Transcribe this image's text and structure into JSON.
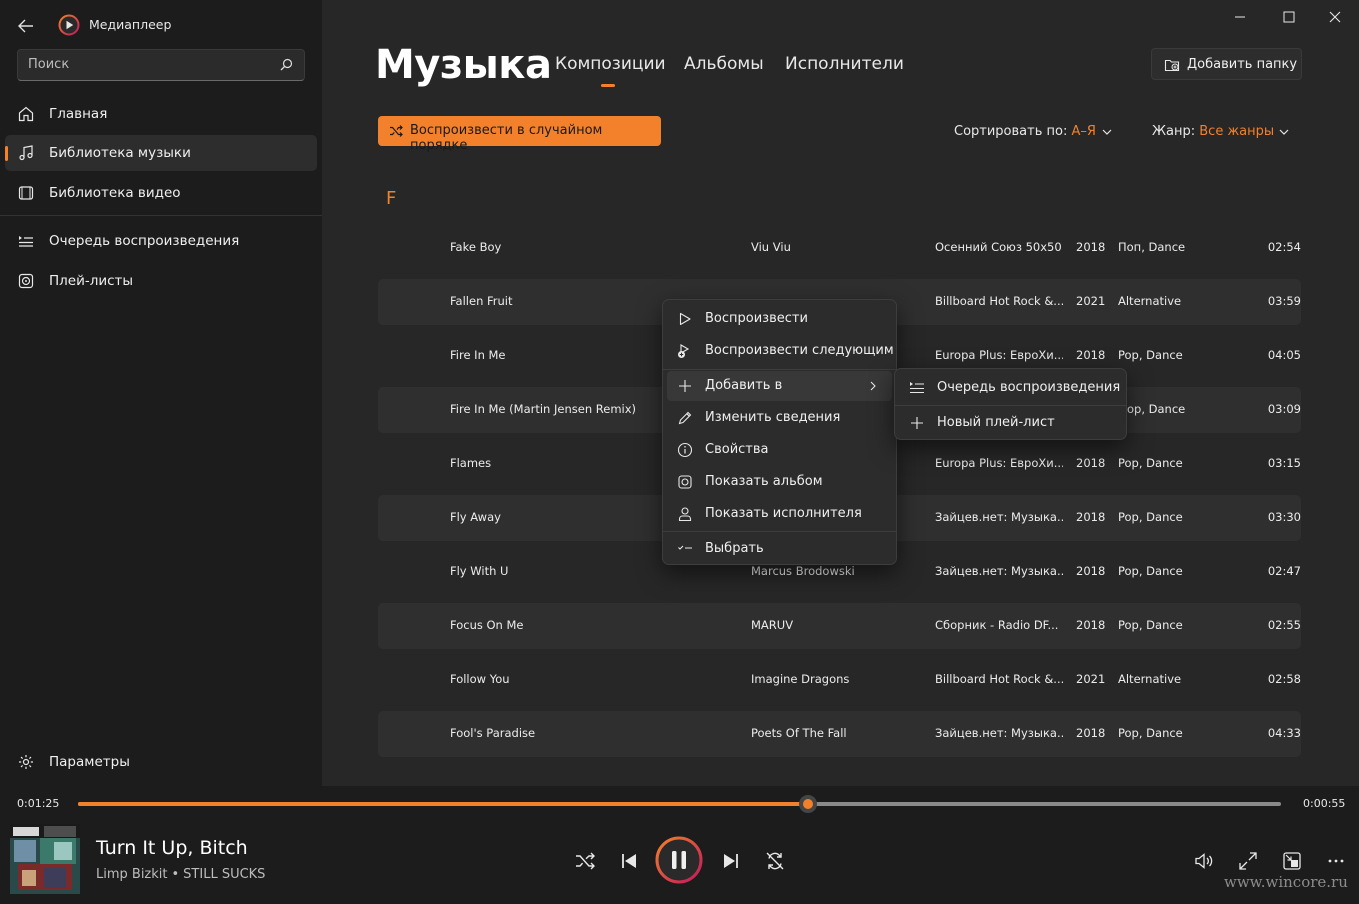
{
  "app": {
    "title": "Медиаплеер"
  },
  "search": {
    "placeholder": "Поиск"
  },
  "sidebar": {
    "items": [
      {
        "label": "Главная",
        "icon": "home-icon"
      },
      {
        "label": "Библиотека музыки",
        "icon": "music-note-icon",
        "active": true
      },
      {
        "label": "Библиотека видео",
        "icon": "film-icon"
      },
      {
        "label": "Очередь воспроизведения",
        "icon": "queue-icon"
      },
      {
        "label": "Плей-листы",
        "icon": "playlist-icon"
      }
    ],
    "settings_label": "Параметры"
  },
  "header": {
    "title": "Музыка",
    "tabs": [
      {
        "label": "Композиции",
        "active": true
      },
      {
        "label": "Альбомы"
      },
      {
        "label": "Исполнители"
      }
    ],
    "add_folder_label": "Добавить папку"
  },
  "toolbar": {
    "shuffle_label": "Воспроизвести в случайном порядке",
    "sort_label": "Сортировать по:",
    "sort_value": "А–Я",
    "genre_label": "Жанр:",
    "genre_value": "Все жанры"
  },
  "section_letter": "F",
  "songs": [
    {
      "title": "Fake Boy",
      "artist": "Viu Viu",
      "album": "Осенний Союз 50x50",
      "year": "2018",
      "genre": "Поп, Dance",
      "duration": "02:54"
    },
    {
      "title": "Fallen Fruit",
      "artist": "",
      "album": "Billboard Hot Rock &...",
      "year": "2021",
      "genre": "Alternative",
      "duration": "03:59"
    },
    {
      "title": "Fire In Me",
      "artist": "",
      "album": "Europa Plus: ЕвроХи...",
      "year": "2018",
      "genre": "Pop, Dance",
      "duration": "04:05"
    },
    {
      "title": "Fire In Me (Martin Jensen Remix)",
      "artist": "",
      "album": "",
      "year": "",
      "genre": "op, Dance",
      "duration": "03:09"
    },
    {
      "title": "Flames",
      "artist": "",
      "album": "Europa Plus: ЕвроХи...",
      "year": "2018",
      "genre": "Pop, Dance",
      "duration": "03:15"
    },
    {
      "title": "Fly Away",
      "artist": "",
      "album": "Зайцев.нет: Музыка...",
      "year": "2018",
      "genre": "Pop, Dance",
      "duration": "03:30"
    },
    {
      "title": "Fly With U",
      "artist": "Marcus Brodowski",
      "album": "Зайцев.нет: Музыка...",
      "year": "2018",
      "genre": "Pop, Dance",
      "duration": "02:47"
    },
    {
      "title": "Focus On Me",
      "artist": "MARUV",
      "album": "Сборник - Radio DF...",
      "year": "2018",
      "genre": "Pop, Dance",
      "duration": "02:55"
    },
    {
      "title": "Follow You",
      "artist": "Imagine Dragons",
      "album": "Billboard Hot Rock &...",
      "year": "2021",
      "genre": "Alternative",
      "duration": "02:58"
    },
    {
      "title": "Fool's Paradise",
      "artist": "Poets Of The Fall",
      "album": "Зайцев.нет: Музыка...",
      "year": "2018",
      "genre": "Pop, Dance",
      "duration": "04:33"
    }
  ],
  "context_menu": {
    "items": [
      {
        "label": "Воспроизвести",
        "icon": "play-icon"
      },
      {
        "label": "Воспроизвести следующим",
        "icon": "play-next-icon"
      },
      {
        "label": "Добавить в",
        "icon": "plus-icon",
        "has_submenu": true
      },
      {
        "label": "Изменить сведения",
        "icon": "pencil-icon"
      },
      {
        "label": "Свойства",
        "icon": "info-icon"
      },
      {
        "label": "Показать альбом",
        "icon": "album-icon"
      },
      {
        "label": "Показать исполнителя",
        "icon": "person-icon"
      },
      {
        "label": "Выбрать",
        "icon": "select-icon"
      }
    ]
  },
  "submenu": {
    "items": [
      {
        "label": "Очередь воспроизведения",
        "icon": "queue-icon"
      },
      {
        "label": "Новый плей-лист",
        "icon": "plus-icon"
      }
    ]
  },
  "player": {
    "elapsed": "0:01:25",
    "remaining": "0:00:55",
    "progress_percent": 60.7,
    "track_title": "Turn It Up, Bitch",
    "artist": "Limp Bizkit",
    "album": "STILL SUCKS",
    "separator": "•",
    "state": "playing"
  },
  "watermark": "www.wincore.ru",
  "colors": {
    "accent": "#f3812c",
    "sidebar_bg": "#1c1c1c",
    "main_bg": "#272727",
    "row_alt": "#2f2f2f",
    "menu_bg": "#2c2c2c"
  }
}
